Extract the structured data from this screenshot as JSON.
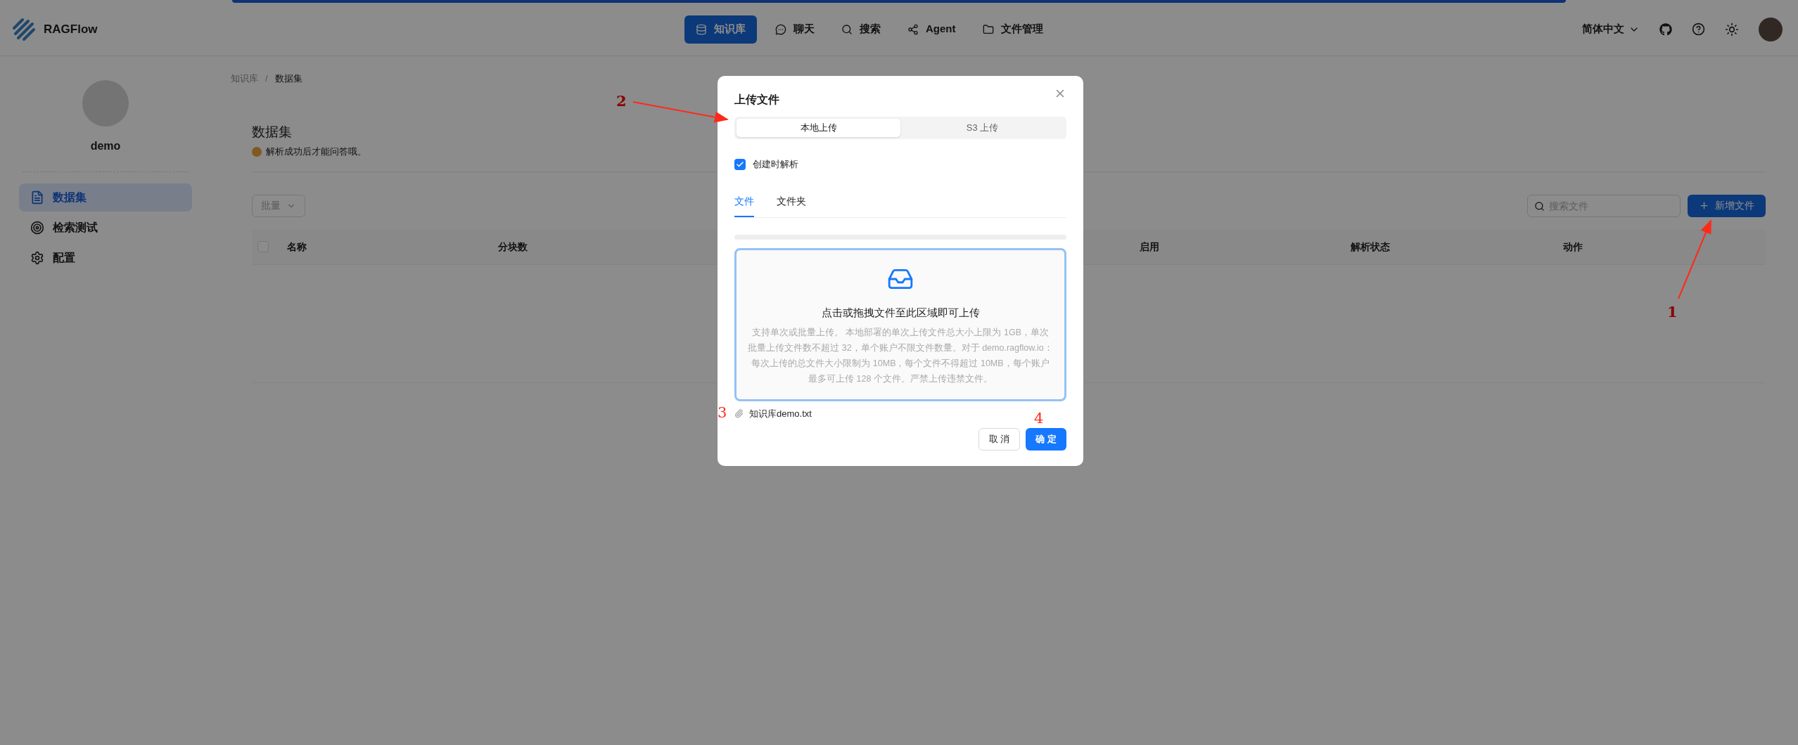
{
  "header": {
    "app_name": "RAGFlow",
    "nav": [
      {
        "label": "知识库",
        "selected": true
      },
      {
        "label": "聊天",
        "selected": false
      },
      {
        "label": "搜索",
        "selected": false
      },
      {
        "label": "Agent",
        "selected": false
      },
      {
        "label": "文件管理",
        "selected": false
      }
    ],
    "language": "简体中文"
  },
  "sidebar": {
    "user": "demo",
    "items": [
      {
        "label": "数据集",
        "selected": true
      },
      {
        "label": "检索测试",
        "selected": false
      },
      {
        "label": "配置",
        "selected": false
      }
    ]
  },
  "breadcrumb": {
    "items": [
      {
        "label": "知识库",
        "current": false
      },
      {
        "label": "数据集",
        "current": true
      }
    ],
    "separator": "/"
  },
  "page": {
    "title": "数据集",
    "subtitle": "解析成功后才能问答哦。",
    "bulk_button": "批量",
    "search": {
      "placeholder": "搜索文件"
    },
    "add_button": "新增文件"
  },
  "table": {
    "select_all_checked": false,
    "columns": [
      "名称",
      "分块数",
      "启用",
      "解析状态",
      "动作"
    ]
  },
  "dialog": {
    "title": "上传文件",
    "sources": [
      {
        "label": "本地上传",
        "selected": true
      },
      {
        "label": "S3 上传",
        "selected": false
      }
    ],
    "parse_on_create": {
      "label": "创建时解析",
      "checked": true
    },
    "tabs": [
      {
        "label": "文件",
        "selected": true
      },
      {
        "label": "文件夹",
        "selected": false
      }
    ],
    "dropzone": {
      "title": "点击或拖拽文件至此区域即可上传",
      "hint": "支持单次或批量上传。 本地部署的单次上传文件总大小上限为 1GB，单次批量上传文件数不超过 32，单个账户不限文件数量。对于 demo.ragflow.io：每次上传的总文件大小限制为 10MB，每个文件不得超过 10MB，每个账户最多可上传 128 个文件。严禁上传违禁文件。"
    },
    "files": [
      "知识库demo.txt"
    ],
    "cancel": "取 消",
    "ok": "确 定"
  },
  "annotations": [
    "1",
    "2",
    "3",
    "4"
  ]
}
